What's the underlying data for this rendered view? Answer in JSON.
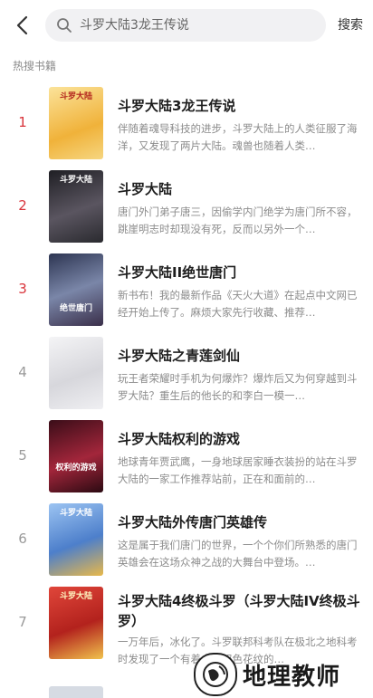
{
  "header": {
    "back_icon": "chevron-left-icon",
    "search_icon": "search-icon",
    "search_placeholder": "斗罗大陆3龙王传说",
    "search_button": "搜索"
  },
  "section_title": "热搜书籍",
  "books": [
    {
      "rank": "1",
      "title": "斗罗大陆3龙王传说",
      "desc": "伴随着魂导科技的进步，斗罗大陆上的人类征服了海洋，又发现了两片大陆。魂兽也随着人类…",
      "cover_text": "斗罗大陆",
      "cover_color": "#f3c94a"
    },
    {
      "rank": "2",
      "title": "斗罗大陆",
      "desc": "唐门外门弟子唐三，因偷学内门绝学为唐门所不容，跳崖明志时却现没有死，反而以另外一个…",
      "cover_text": "斗罗大陆",
      "cover_color": "#3b3a3f"
    },
    {
      "rank": "3",
      "title": "斗罗大陆II绝世唐门",
      "desc": "新书布！我的最新作品《天火大道》在起点中文网已经开始上传了。麻烦大家先行收藏、推荐…",
      "cover_text": "绝世唐门",
      "cover_color": "#4e5a78"
    },
    {
      "rank": "4",
      "title": "斗罗大陆之青莲剑仙",
      "desc": "玩王者荣耀时手机为何爆炸？爆炸后又为何穿越到斗罗大陆？重生后的他长的和李白一模一…",
      "cover_text": "",
      "cover_color": "#e6e6e8"
    },
    {
      "rank": "5",
      "title": "斗罗大陆权利的游戏",
      "desc": "地球青年贾武鹰，一身地球居家睡衣装扮的站在斗罗大陆的一家工作推荐站前，正在和面前的…",
      "cover_text": "权利的游戏",
      "cover_color": "#7a1b2a"
    },
    {
      "rank": "6",
      "title": "斗罗大陆外传唐门英雄传",
      "desc": "这是属于我们唐门的世界，一个个你们所熟悉的唐门英雄会在这场众神之战的大舞台中登场。…",
      "cover_text": "斗罗大陆",
      "cover_color": "#5f8fd1"
    },
    {
      "rank": "7",
      "title": "斗罗大陆4终极斗罗（斗罗大陆IV终极斗罗）",
      "desc": "一万年后，冰化了。斗罗联邦科考队在极北之地科考时发现了一个有着金银双色花纹的…",
      "cover_text": "斗罗大陆",
      "cover_color": "#c8322b"
    }
  ],
  "watermark": {
    "text": "地理教师",
    "logo_icon": "globe-logo-icon"
  }
}
